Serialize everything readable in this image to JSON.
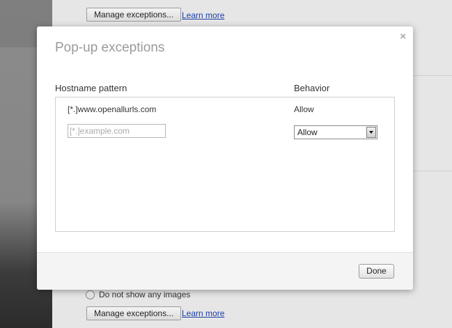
{
  "background": {
    "top_manage_button": "Manage exceptions...",
    "top_learn_more": "Learn more",
    "radio_label": "Do not show any images",
    "bottom_manage_button": "Manage exceptions...",
    "bottom_learn_more": "Learn more"
  },
  "dialog": {
    "title": "Pop-up exceptions",
    "close_glyph": "×",
    "columns": {
      "hostname": "Hostname pattern",
      "behavior": "Behavior"
    },
    "rows": [
      {
        "host": "[*.]www.openallurls.com",
        "behavior": "Allow"
      }
    ],
    "new_entry": {
      "host_placeholder": "[*.]example.com",
      "host_value": "",
      "behavior_selected": "Allow"
    },
    "done_label": "Done"
  }
}
